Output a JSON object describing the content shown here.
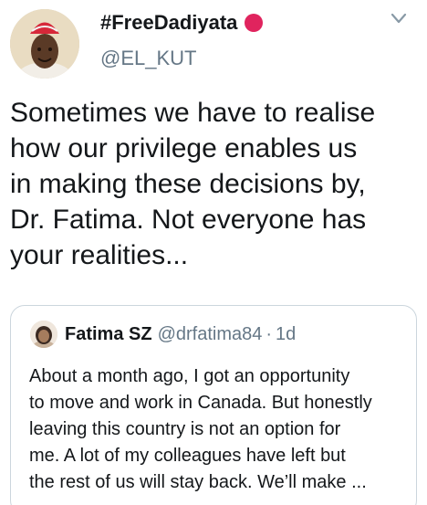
{
  "author": {
    "display_name": "#FreeDadiyata",
    "handle": "@EL_KUT",
    "status_emoji": "red-circle-icon"
  },
  "tweet": {
    "lines": [
      "Sometimes we have to realise",
      "how our privilege enables us",
      "in making these decisions by,",
      "Dr. Fatima. Not everyone has",
      "your realities..."
    ]
  },
  "quoted": {
    "name": "Fatima SZ",
    "handle": "@drfatima84",
    "separator": "·",
    "time": "1d",
    "lines": [
      "About a month ago, I got an opportunity",
      "to move and work in Canada. But honestly",
      "leaving this country is not an option for",
      "me. A lot of my colleagues have left but",
      "the rest of us will stay back. We’ll make ..."
    ]
  },
  "colors": {
    "text": "#14171a",
    "secondary": "#657786",
    "border": "#ccd6dd",
    "cap_red": "#e0245e"
  }
}
